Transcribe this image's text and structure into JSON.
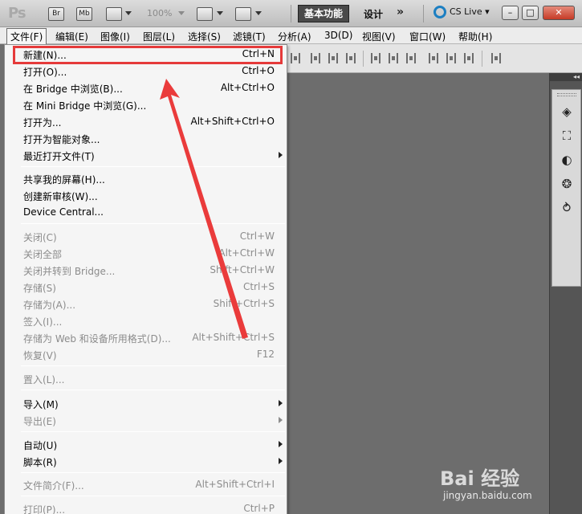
{
  "titlebar": {
    "logo": "Ps",
    "br_label": "Br",
    "mb_label": "Mb",
    "zoom": "100%",
    "workspace_active": "基本功能",
    "workspace_design": "设计",
    "more": "»",
    "cs_live": "CS Live",
    "minimize": "–",
    "restore": "□",
    "close": "✕"
  },
  "menubar": {
    "items": [
      {
        "label": "文件(F)"
      },
      {
        "label": "编辑(E)"
      },
      {
        "label": "图像(I)"
      },
      {
        "label": "图层(L)"
      },
      {
        "label": "选择(S)"
      },
      {
        "label": "滤镜(T)"
      },
      {
        "label": "分析(A)"
      },
      {
        "label": "3D(D)"
      },
      {
        "label": "视图(V)"
      },
      {
        "label": "窗口(W)"
      },
      {
        "label": "帮助(H)"
      }
    ]
  },
  "file_menu": {
    "items": [
      {
        "label": "新建(N)...",
        "shortcut": "Ctrl+N",
        "enabled": true
      },
      {
        "label": "打开(O)...",
        "shortcut": "Ctrl+O",
        "enabled": true
      },
      {
        "label": "在 Bridge 中浏览(B)...",
        "shortcut": "Alt+Ctrl+O",
        "enabled": true
      },
      {
        "label": "在 Mini Bridge 中浏览(G)...",
        "shortcut": "",
        "enabled": true
      },
      {
        "label": "打开为...",
        "shortcut": "Alt+Shift+Ctrl+O",
        "enabled": true
      },
      {
        "label": "打开为智能对象...",
        "shortcut": "",
        "enabled": true
      },
      {
        "label": "最近打开文件(T)",
        "shortcut": "",
        "enabled": true,
        "submenu": true
      },
      {
        "label": "共享我的屏幕(H)...",
        "shortcut": "",
        "enabled": true
      },
      {
        "label": "创建新审核(W)...",
        "shortcut": "",
        "enabled": true
      },
      {
        "label": "Device Central...",
        "shortcut": "",
        "enabled": true
      },
      {
        "label": "关闭(C)",
        "shortcut": "Ctrl+W",
        "enabled": false
      },
      {
        "label": "关闭全部",
        "shortcut": "Alt+Ctrl+W",
        "enabled": false
      },
      {
        "label": "关闭并转到 Bridge...",
        "shortcut": "Shift+Ctrl+W",
        "enabled": false
      },
      {
        "label": "存储(S)",
        "shortcut": "Ctrl+S",
        "enabled": false
      },
      {
        "label": "存储为(A)...",
        "shortcut": "Shift+Ctrl+S",
        "enabled": false
      },
      {
        "label": "签入(I)...",
        "shortcut": "",
        "enabled": false
      },
      {
        "label": "存储为 Web 和设备所用格式(D)...",
        "shortcut": "Alt+Shift+Ctrl+S",
        "enabled": false
      },
      {
        "label": "恢复(V)",
        "shortcut": "F12",
        "enabled": false
      },
      {
        "label": "置入(L)...",
        "shortcut": "",
        "enabled": false
      },
      {
        "label": "导入(M)",
        "shortcut": "",
        "enabled": true,
        "submenu": true
      },
      {
        "label": "导出(E)",
        "shortcut": "",
        "enabled": false,
        "submenu": true
      },
      {
        "label": "自动(U)",
        "shortcut": "",
        "enabled": true,
        "submenu": true
      },
      {
        "label": "脚本(R)",
        "shortcut": "",
        "enabled": true,
        "submenu": true
      },
      {
        "label": "文件简介(F)...",
        "shortcut": "Alt+Shift+Ctrl+I",
        "enabled": false
      },
      {
        "label": "打印(P)...",
        "shortcut": "Ctrl+P",
        "enabled": false
      }
    ]
  },
  "watermark": {
    "brand": "Bai 经验",
    "url": "jingyan.baidu.com"
  },
  "colors": {
    "highlight": "#e53a3a",
    "arrow": "#ea3b3b",
    "workspace": "#6d6d6d"
  }
}
